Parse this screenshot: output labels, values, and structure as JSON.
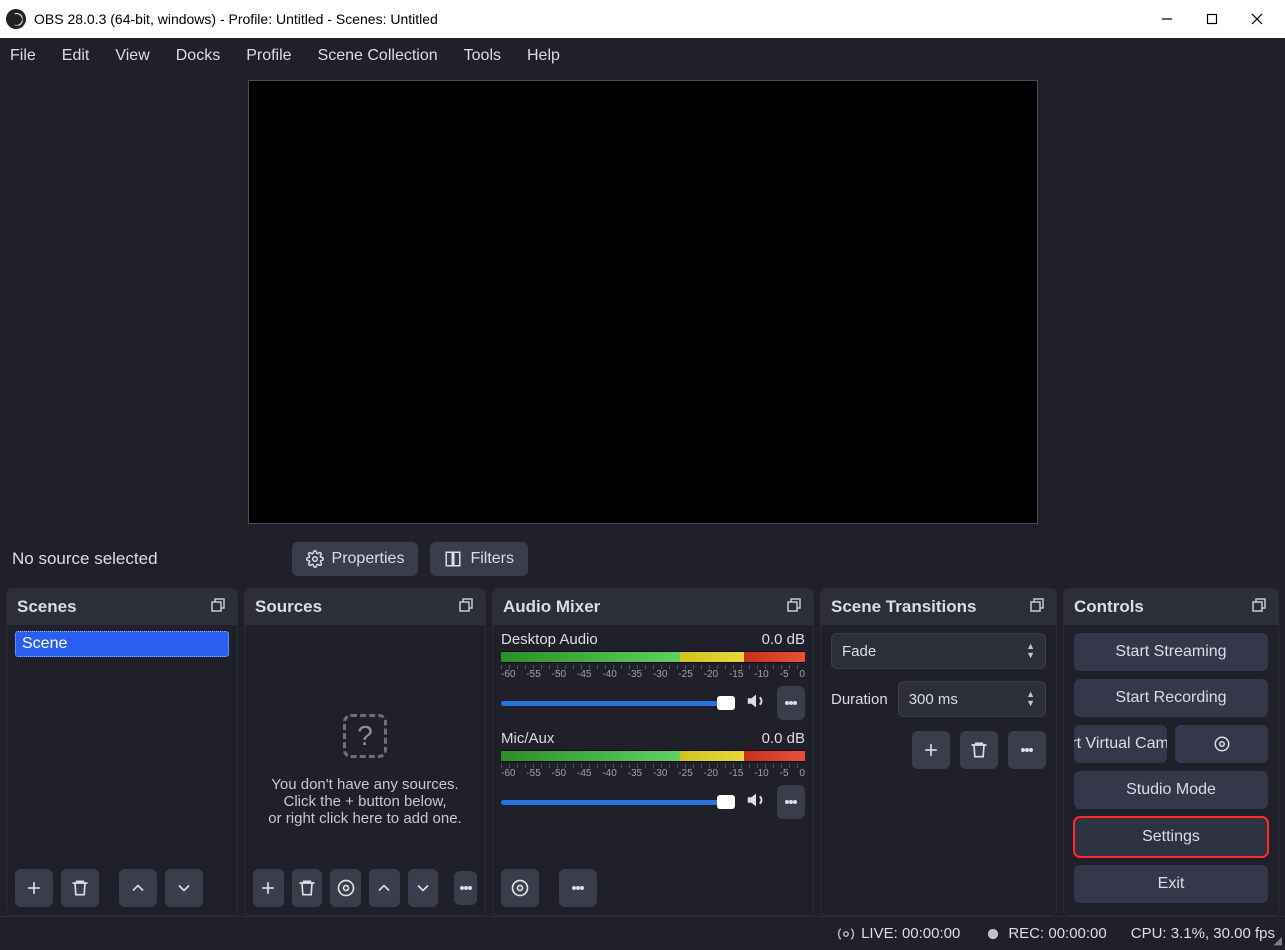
{
  "titlebar": {
    "title": "OBS 28.0.3 (64-bit, windows) - Profile: Untitled - Scenes: Untitled"
  },
  "menubar": [
    "File",
    "Edit",
    "View",
    "Docks",
    "Profile",
    "Scene Collection",
    "Tools",
    "Help"
  ],
  "sourcebar": {
    "label": "No source selected",
    "properties": "Properties",
    "filters": "Filters"
  },
  "scenes_dock": {
    "title": "Scenes",
    "items": [
      "Scene"
    ]
  },
  "sources_dock": {
    "title": "Sources",
    "empty_l1": "You don't have any sources.",
    "empty_l2": "Click the + button below,",
    "empty_l3": "or right click here to add one."
  },
  "mixer_dock": {
    "title": "Audio Mixer",
    "channels": [
      {
        "name": "Desktop Audio",
        "db": "0.0 dB"
      },
      {
        "name": "Mic/Aux",
        "db": "0.0 dB"
      }
    ],
    "scale": [
      "-60",
      "-55",
      "-50",
      "-45",
      "-40",
      "-35",
      "-30",
      "-25",
      "-20",
      "-15",
      "-10",
      "-5",
      "0"
    ]
  },
  "transitions_dock": {
    "title": "Scene Transitions",
    "selected": "Fade",
    "duration_label": "Duration",
    "duration_value": "300 ms"
  },
  "controls_dock": {
    "title": "Controls",
    "buttons": {
      "stream": "Start Streaming",
      "record": "Start Recording",
      "vcam": "tart Virtual Camer",
      "studio": "Studio Mode",
      "settings": "Settings",
      "exit": "Exit"
    }
  },
  "statusbar": {
    "live": "LIVE: 00:00:00",
    "rec": "REC: 00:00:00",
    "cpu": "CPU: 3.1%, 30.00 fps"
  }
}
